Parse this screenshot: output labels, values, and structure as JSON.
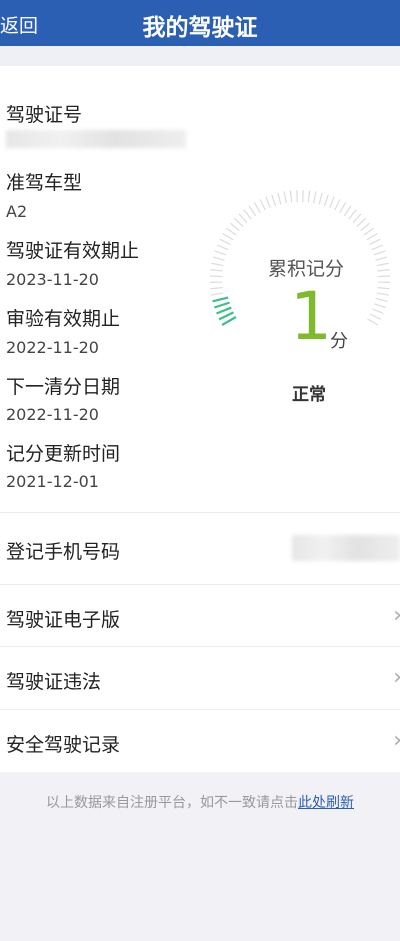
{
  "header": {
    "back_label": "返回",
    "title": "我的驾驶证"
  },
  "license": {
    "number_label": "驾驶证号",
    "class_label": "准驾车型",
    "class_value": "A2",
    "valid_until_label": "驾驶证有效期止",
    "valid_until_value": "2023-11-20",
    "inspection_until_label": "审验有效期止",
    "inspection_until_value": "2022-11-20",
    "next_clear_label": "下一清分日期",
    "next_clear_value": "2022-11-20",
    "points_updated_label": "记分更新时间",
    "points_updated_value": "2021-12-01"
  },
  "points": {
    "label": "累积记分",
    "value": "1",
    "unit": "分",
    "status": "正常",
    "ring_color": "#dcdcdc",
    "fill_color": "#3dbf8a",
    "number_color": "#7fb92e"
  },
  "menu": {
    "phone_label": "登记手机号码",
    "electronic_label": "驾驶证电子版",
    "violations_label": "驾驶证违法",
    "safe_record_label": "安全驾驶记录",
    "chevron": "›"
  },
  "footer": {
    "note": "以上数据来自注册平台，如不一致请点击",
    "refresh_link": "此处刷新"
  },
  "colors": {
    "header_bg": "#2b5fb4",
    "link": "#2b5fb4"
  }
}
